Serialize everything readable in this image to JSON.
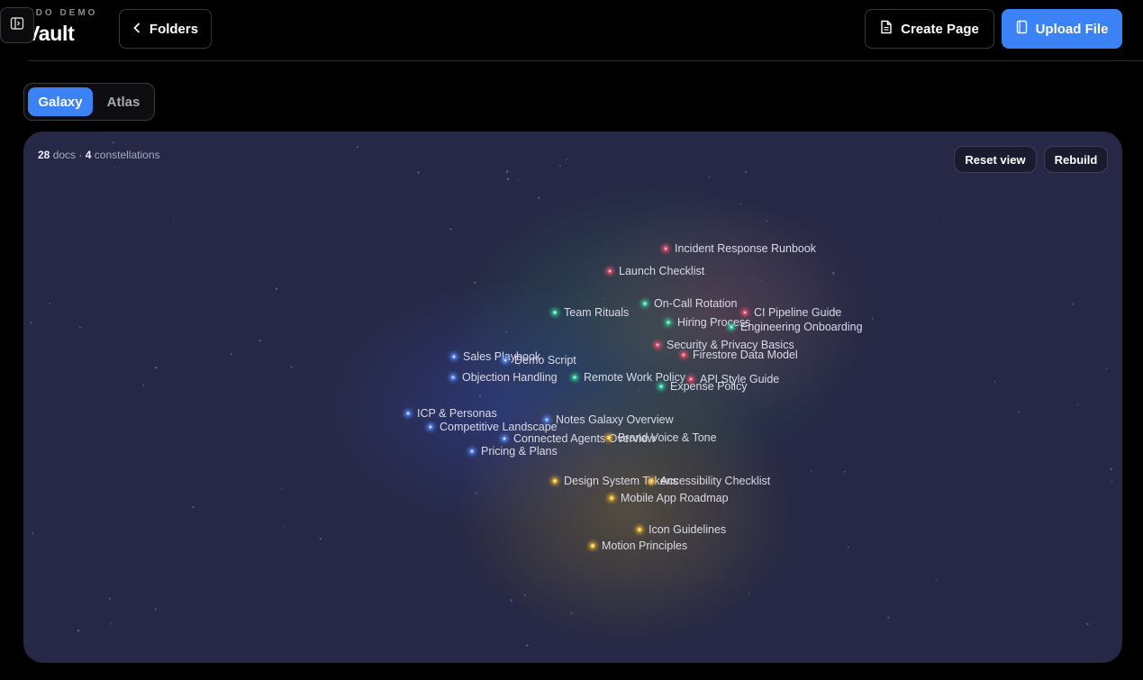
{
  "header": {
    "workspace": "YDO DEMO",
    "title": "Vault",
    "back_label": "Folders",
    "create_label": "Create Page",
    "upload_label": "Upload File"
  },
  "tabs": [
    {
      "label": "Galaxy",
      "active": true
    },
    {
      "label": "Atlas",
      "active": false
    }
  ],
  "galaxy": {
    "docs_count": "28",
    "docs_word": "docs",
    "separator": "·",
    "constellations_count": "4",
    "constellations_word": "constellations",
    "reset_label": "Reset view",
    "rebuild_label": "Rebuild"
  },
  "colors": {
    "accent": "#3b82f6",
    "red": "#f0506e",
    "green": "#34d399",
    "blue": "#5b8cff",
    "yellow": "#f5b82e"
  },
  "nodes": [
    {
      "label": "Incident Response Runbook",
      "group": "red"
    },
    {
      "label": "Launch Checklist",
      "group": "red"
    },
    {
      "label": "On-Call Rotation",
      "group": "green"
    },
    {
      "label": "Team Rituals",
      "group": "green"
    },
    {
      "label": "CI Pipeline Guide",
      "group": "red"
    },
    {
      "label": "Hiring Process",
      "group": "green"
    },
    {
      "label": "Engineering Onboarding",
      "group": "green"
    },
    {
      "label": "Security & Privacy Basics",
      "group": "red"
    },
    {
      "label": "Firestore Data Model",
      "group": "red"
    },
    {
      "label": "Sales Playbook",
      "group": "blue"
    },
    {
      "label": "Demo Script",
      "group": "blue"
    },
    {
      "label": "Objection Handling",
      "group": "blue"
    },
    {
      "label": "Remote Work Policy",
      "group": "green"
    },
    {
      "label": "API Style Guide",
      "group": "red"
    },
    {
      "label": "Expense Policy",
      "group": "green"
    },
    {
      "label": "ICP & Personas",
      "group": "blue"
    },
    {
      "label": "Notes Galaxy Overview",
      "group": "blue"
    },
    {
      "label": "Competitive Landscape",
      "group": "blue"
    },
    {
      "label": "Connected Agents Overview",
      "group": "blue"
    },
    {
      "label": "Brand Voice & Tone",
      "group": "yellow"
    },
    {
      "label": "Pricing & Plans",
      "group": "blue"
    },
    {
      "label": "Design System Tokens",
      "group": "yellow"
    },
    {
      "label": "Accessibility Checklist",
      "group": "yellow"
    },
    {
      "label": "Mobile App Roadmap",
      "group": "yellow"
    },
    {
      "label": "Icon Guidelines",
      "group": "yellow"
    },
    {
      "label": "Motion Principles",
      "group": "yellow"
    }
  ]
}
